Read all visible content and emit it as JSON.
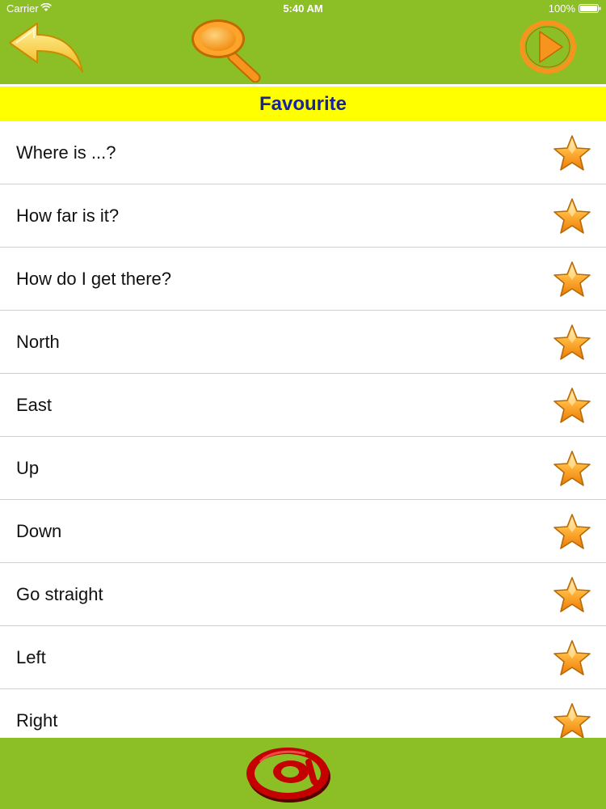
{
  "status": {
    "carrier": "Carrier",
    "time": "5:40 AM",
    "battery": "100%"
  },
  "header": {
    "title": "Favourite",
    "back_icon": "arrow-back-icon",
    "search_icon": "search-icon",
    "play_icon": "play-icon"
  },
  "list": {
    "items": [
      {
        "label": "Where is ...?"
      },
      {
        "label": "How far is it?"
      },
      {
        "label": "How do I get there?"
      },
      {
        "label": "North"
      },
      {
        "label": "East"
      },
      {
        "label": "Up"
      },
      {
        "label": "Down"
      },
      {
        "label": "Go straight"
      },
      {
        "label": "Left"
      },
      {
        "label": "Right"
      }
    ],
    "item_icon": "star-icon"
  },
  "footer": {
    "contact_icon": "at-sign-icon"
  },
  "colors": {
    "bar": "#8cbf26",
    "banner": "#ffff00",
    "title_text": "#17249c",
    "icon_orange": "#f7941d",
    "at_red": "#c40000"
  }
}
